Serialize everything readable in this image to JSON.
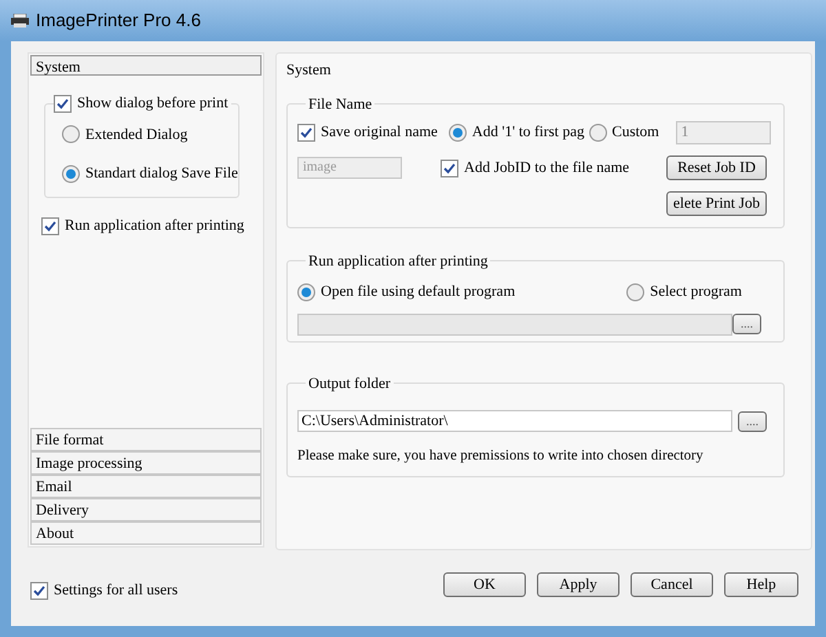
{
  "window": {
    "title": "ImagePrinter Pro 4.6"
  },
  "sidebar": {
    "tabs": [
      {
        "label": "System",
        "selected": true
      }
    ],
    "show_dialog": {
      "label": "Show dialog before print",
      "checked": true,
      "options": [
        {
          "label": "Extended Dialog",
          "selected": false
        },
        {
          "label": "Standart dialog Save File",
          "selected": true
        }
      ]
    },
    "run_application": {
      "label": "Run application after printing",
      "checked": true
    },
    "sections": [
      {
        "label": "File format",
        "selected": false
      },
      {
        "label": "Image processing",
        "selected": false
      },
      {
        "label": "Email",
        "selected": false
      },
      {
        "label": "Delivery",
        "selected": false
      },
      {
        "label": "About",
        "selected": false
      }
    ]
  },
  "panel": {
    "title": "System",
    "file_name": {
      "title": "File Name",
      "save_original": {
        "label": "Save original name",
        "checked": true
      },
      "page_options": [
        {
          "label": "Add '1' to first pag",
          "selected": true
        },
        {
          "label": "Custom",
          "selected": false
        }
      ],
      "custom_value": "1",
      "name_value": "image",
      "add_jobid": {
        "label": "Add JobID to the file name",
        "checked": true
      },
      "buttons": [
        "Reset Job ID",
        "elete Print Job"
      ]
    },
    "run_application": {
      "title": "Run application after printing",
      "options": [
        {
          "label": "Open file using default program",
          "selected": true
        },
        {
          "label": "Select program",
          "selected": false
        }
      ],
      "browse": "...."
    },
    "output_folder": {
      "title": "Output folder",
      "path": "C:\\Users\\Administrator\\",
      "browse": "....",
      "note": "Please make sure, you have premissions to write into chosen directory"
    }
  },
  "settings_for_all_users": {
    "label": "Settings for all users",
    "checked": true
  },
  "buttons": [
    "OK",
    "Apply",
    "Cancel",
    "Help"
  ]
}
